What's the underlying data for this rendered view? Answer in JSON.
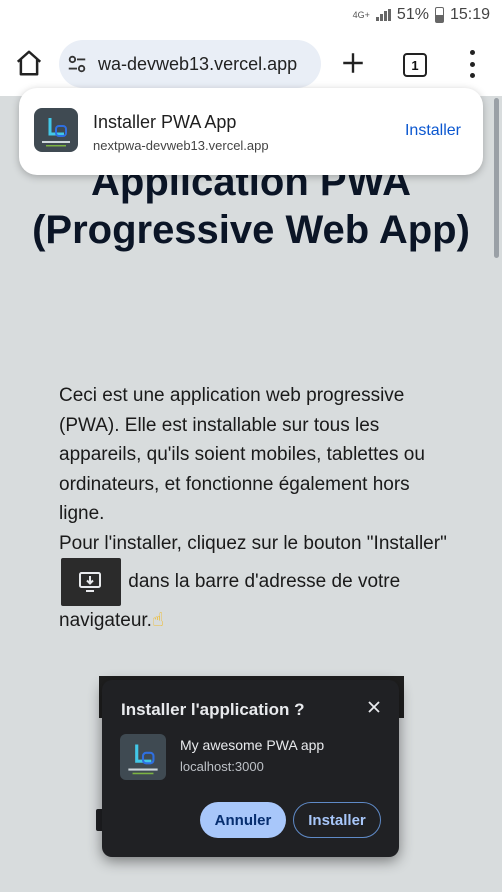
{
  "status_bar": {
    "network": "4G+",
    "battery": "51%",
    "time": "15:19"
  },
  "browser": {
    "url": "wa-devweb13.vercel.app",
    "tab_count": "1"
  },
  "install_banner": {
    "title": "Installer PWA App",
    "url": "nextpwa-devweb13.vercel.app",
    "action": "Installer"
  },
  "page": {
    "title": "Application PWA (Progressive Web App)",
    "paragraph1": "Ceci est une application web progressive (PWA). Elle est installable sur tous les appareils, qu'ils soient mobiles, tablettes ou ordinateurs, et fonctionne également hors ligne.",
    "paragraph2_before": "Pour l'installer, cliquez sur le bouton \"Installer\"",
    "paragraph2_after": "dans la barre d'adresse de votre navigateur.",
    "pointing_emoji": "☝"
  },
  "install_dialog": {
    "title": "Installer l'application ?",
    "app_name": "My awesome PWA app",
    "app_url": "localhost:3000",
    "cancel_label": "Annuler",
    "install_label": "Installer"
  },
  "colors": {
    "accent": "#0b57d0",
    "dialog_bg": "#202124",
    "button_primary": "#a8c7fa"
  }
}
